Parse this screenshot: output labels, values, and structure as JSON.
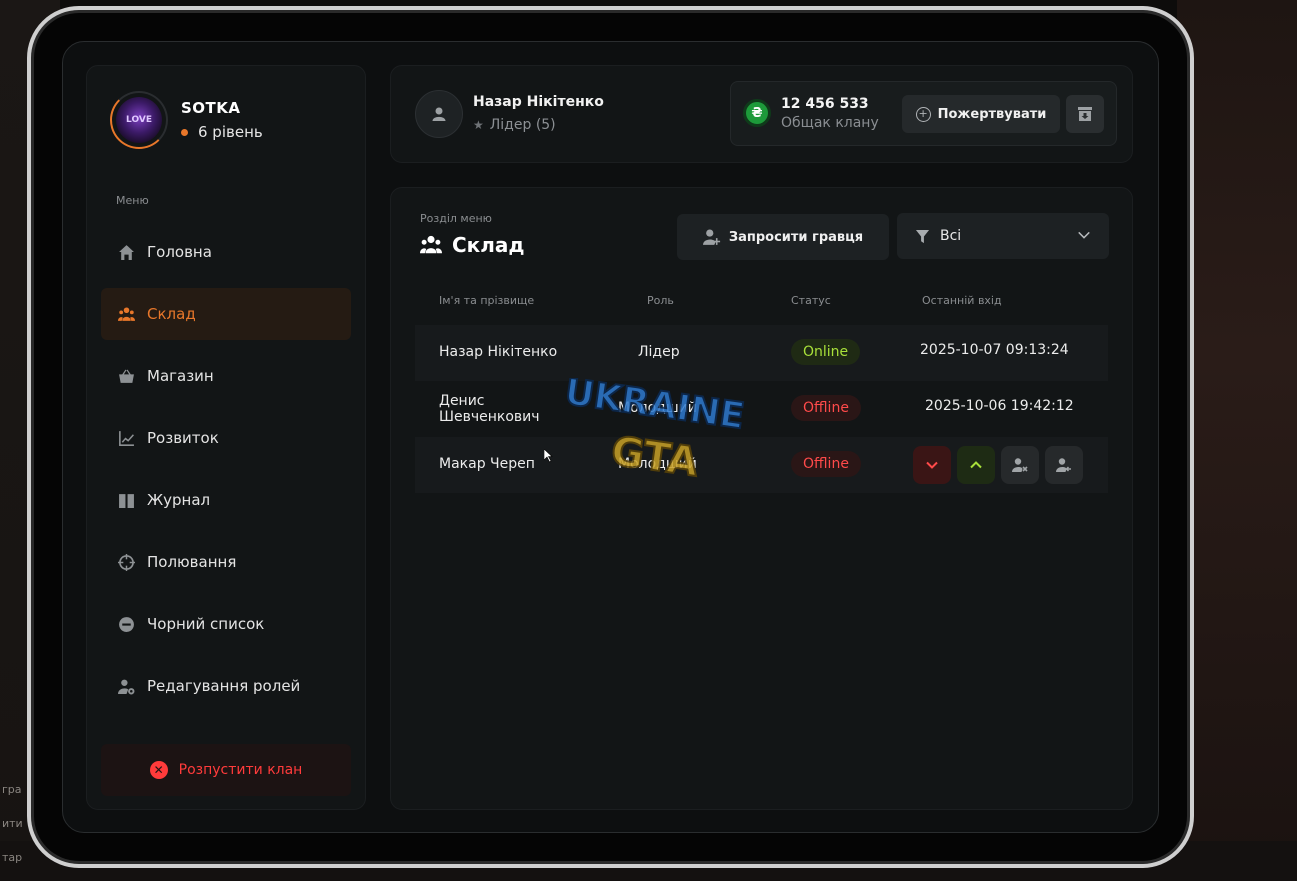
{
  "background_text": [
    "гра",
    "ити",
    "тар"
  ],
  "profile": {
    "clan_name": "SOTKA",
    "clan_level": "6 рівень",
    "avatar_text": "LOVE"
  },
  "menu": {
    "caption": "Меню",
    "items": [
      {
        "label": "Головна",
        "icon": "home-icon"
      },
      {
        "label": "Склад",
        "icon": "users-icon",
        "active": true
      },
      {
        "label": "Магазин",
        "icon": "basket-icon"
      },
      {
        "label": "Розвиток",
        "icon": "chart-icon"
      },
      {
        "label": "Журнал",
        "icon": "book-icon"
      },
      {
        "label": "Полювання",
        "icon": "crosshair-icon"
      },
      {
        "label": "Чорний список",
        "icon": "minus-circle-icon"
      },
      {
        "label": "Редагування ролей",
        "icon": "user-gear-icon"
      }
    ],
    "disband_label": "Розпустити клан"
  },
  "header": {
    "user_name": "Назар Нікітенко",
    "user_role": "Лідер (5)",
    "balance_value": "12 456 533",
    "balance_label": "Общак клану",
    "currency_symbol": "₴",
    "donate_label": "Пожертвувати"
  },
  "main": {
    "section_caption": "Розділ меню",
    "section_title": "Склад",
    "invite_label": "Запросити гравця",
    "filter_value": "Всі",
    "columns": [
      "Ім'я та прізвище",
      "Роль",
      "Статус",
      "Останній вхід"
    ],
    "rows": [
      {
        "name": "Назар Нікітенко",
        "role": "Лідер",
        "status": "Online",
        "last_login": "2025-10-07 09:13:24"
      },
      {
        "name_line1": "Денис",
        "name_line2": "Шевченкович",
        "role": "Молодший",
        "status": "Offline",
        "last_login": "2025-10-06 19:42:12"
      },
      {
        "name": "Макар Череп",
        "role": "Молодший",
        "status": "Offline",
        "last_login": ""
      }
    ]
  },
  "watermark": {
    "line1": "UKRAINE",
    "line2": "GTA"
  },
  "colors": {
    "accent": "#e8772a",
    "online": "#a8e03a",
    "offline": "#ff4a4a",
    "danger": "#ff3b3b",
    "currency": "#1d9a3a"
  }
}
